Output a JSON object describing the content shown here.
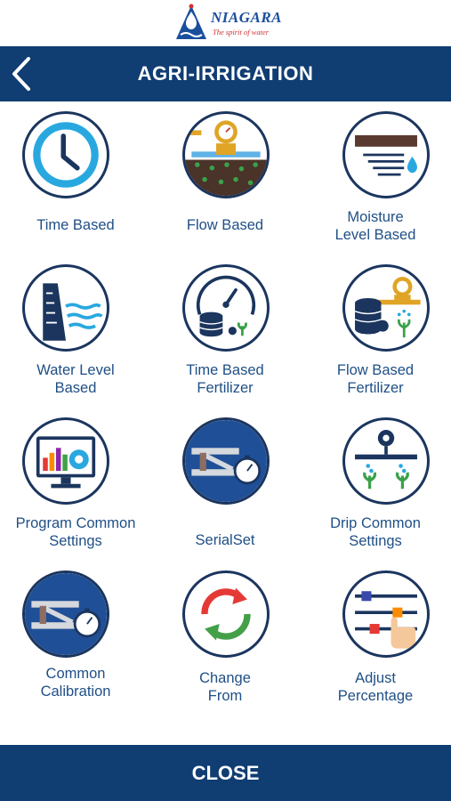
{
  "brand": {
    "name": "NIAGARA",
    "tagline": "The spirit of water"
  },
  "header": {
    "title": "AGRI-IRRIGATION",
    "back_icon": "chevron-left-icon"
  },
  "tiles": [
    {
      "line1": "Time Based",
      "line2": "",
      "icon": "clock-icon"
    },
    {
      "line1": "Flow Based",
      "line2": "",
      "icon": "flow-meter-icon"
    },
    {
      "line1": "Moisture",
      "line2": "Level Based",
      "icon": "moisture-icon"
    },
    {
      "line1": "Water Level",
      "line2": "Based",
      "icon": "water-level-icon"
    },
    {
      "line1": "Time Based",
      "line2": "Fertilizer",
      "icon": "timer-fertilizer-icon"
    },
    {
      "line1": "Flow Based",
      "line2": "Fertilizer",
      "icon": "flow-fertilizer-icon"
    },
    {
      "line1": "Program Common",
      "line2": "Settings",
      "icon": "monitor-chart-icon"
    },
    {
      "line1": "SerialSet",
      "line2": "",
      "icon": "calibration-tools-icon"
    },
    {
      "line1": "Drip Common",
      "line2": "Settings",
      "icon": "drip-icon"
    },
    {
      "line1": "Common",
      "line2": "Calibration",
      "icon": "calibration-tools-icon"
    },
    {
      "line1": "Change",
      "line2": "From",
      "icon": "cycle-arrows-icon"
    },
    {
      "line1": "Adjust",
      "line2": "Percentage",
      "icon": "sliders-hand-icon"
    }
  ],
  "footer": {
    "close_label": "CLOSE"
  },
  "colors": {
    "header_bg": "#103d72",
    "label": "#1f4f86",
    "circle_border": "#1b355e"
  }
}
